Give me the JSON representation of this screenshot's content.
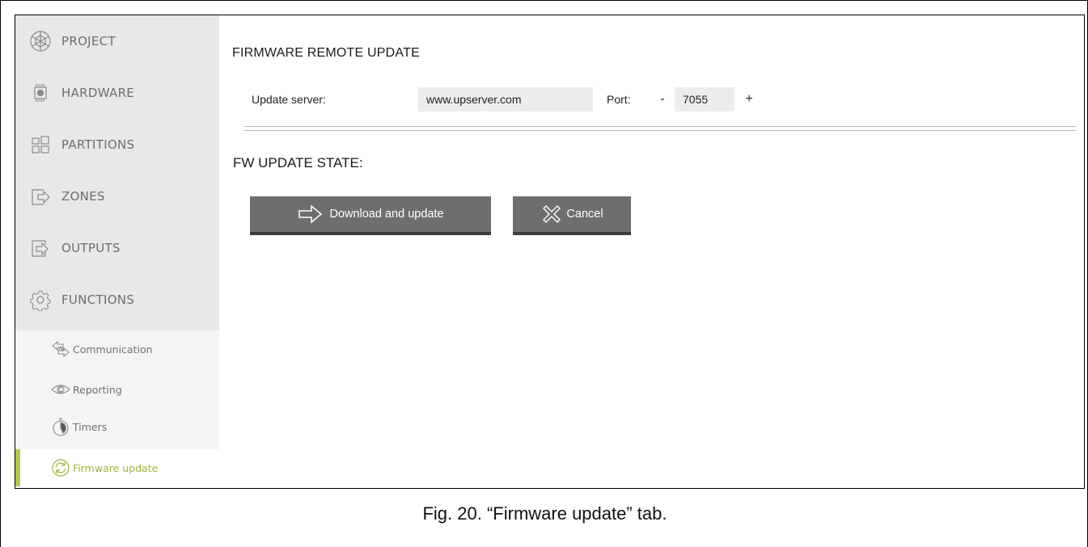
{
  "sidebar": {
    "menu": [
      {
        "label": "PROJECT",
        "icon": "project-icon"
      },
      {
        "label": "HARDWARE",
        "icon": "chip-icon"
      },
      {
        "label": "PARTITIONS",
        "icon": "partitions-icon"
      },
      {
        "label": "ZONES",
        "icon": "zones-icon"
      },
      {
        "label": "OUTPUTS",
        "icon": "outputs-icon"
      },
      {
        "label": "FUNCTIONS",
        "icon": "gear-icon"
      }
    ],
    "submenu": [
      {
        "label": "Communication",
        "icon": "communication-icon"
      },
      {
        "label": "Reporting",
        "icon": "eye-icon"
      },
      {
        "label": "Timers",
        "icon": "stopwatch-icon"
      },
      {
        "label": "Firmware update",
        "icon": "refresh-icon",
        "active": true
      }
    ]
  },
  "main": {
    "section_title": "FIRMWARE REMOTE UPDATE",
    "server_label": "Update server:",
    "server_value": "www.upserver.com",
    "port_label": "Port:",
    "port_minus": "-",
    "port_value": "7055",
    "port_plus": "+",
    "state_title": "FW UPDATE STATE:",
    "download_button": "Download and update",
    "cancel_button": "Cancel"
  },
  "caption": "Fig. 20. “Firmware update” tab.",
  "colors": {
    "sidebar_bg": "#e8e8e8",
    "submenu_bg": "#f4f4f4",
    "active_accent": "#b3c94a",
    "button_bg": "#6e6e6e"
  }
}
